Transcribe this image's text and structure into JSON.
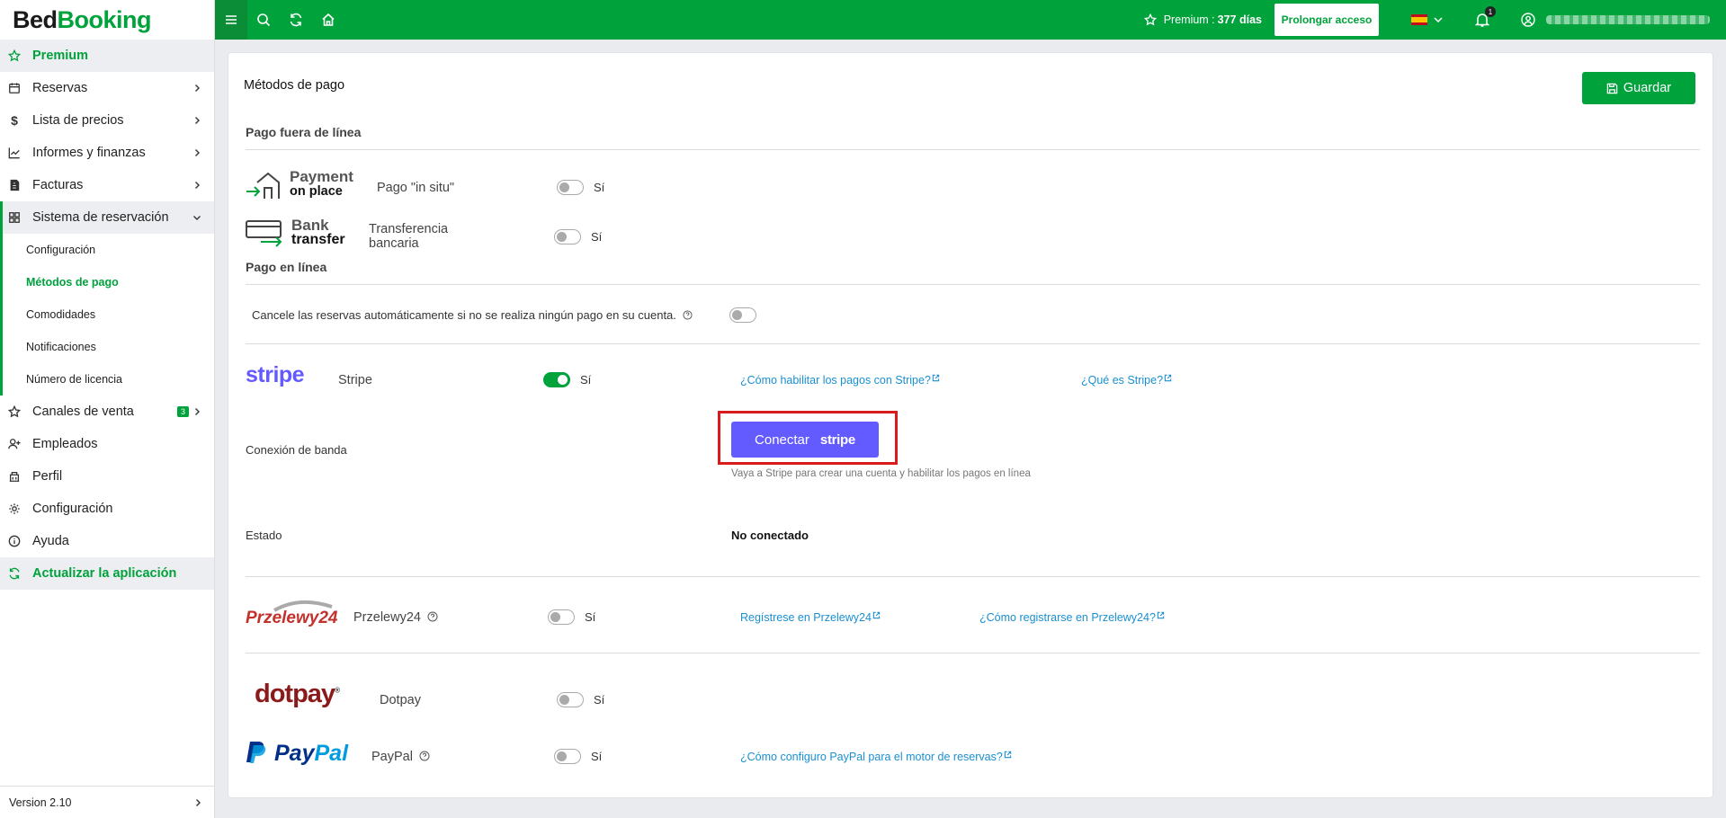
{
  "app": {
    "logo_part1": "Bed",
    "logo_part2": "Booking"
  },
  "sidebar": {
    "premium": "Premium",
    "items": [
      {
        "label": "Reservas"
      },
      {
        "label": "Lista de precios"
      },
      {
        "label": "Informes y finanzas"
      },
      {
        "label": "Facturas"
      },
      {
        "label": "Sistema de reservación"
      }
    ],
    "submenu": [
      {
        "label": "Configuración"
      },
      {
        "label": "Métodos de pago"
      },
      {
        "label": "Comodidades"
      },
      {
        "label": "Notificaciones"
      },
      {
        "label": "Número de licencia"
      }
    ],
    "items2": [
      {
        "label": "Canales de venta",
        "badge": "3"
      },
      {
        "label": "Empleados"
      },
      {
        "label": "Perfil"
      },
      {
        "label": "Configuración"
      },
      {
        "label": "Ayuda"
      }
    ],
    "update": "Actualizar la aplicación",
    "version": "Version 2.10"
  },
  "topbar": {
    "premium_label": "Premium :",
    "premium_days": "377 días",
    "prolong": "Prolongar acceso",
    "notifications": "1"
  },
  "main": {
    "title": "Métodos de pago",
    "save": "Guardar",
    "offline_title": "Pago fuera de línea",
    "online_title": "Pago en línea",
    "toggle_yes": "Sí",
    "payment_on_place": {
      "logo_line1": "Payment",
      "logo_line2": "on place",
      "name": "Pago \"in situ\""
    },
    "bank_transfer": {
      "logo_line1": "Bank",
      "logo_line2": "transfer",
      "name_line1": "Transferencia",
      "name_line2": "bancaria"
    },
    "auto_cancel": "Cancele las reservas automáticamente si no se realiza ningún pago en su cuenta.",
    "stripe": {
      "logo": "stripe",
      "name": "Stripe",
      "link_how": "¿Cómo habilitar los pagos con Stripe?",
      "link_what": "¿Qué es Stripe?",
      "connection_label": "Conexión de banda",
      "connect_label": "Conectar",
      "connect_brand": "stripe",
      "helper": "Vaya a Stripe para crear una cuenta y habilitar los pagos en línea",
      "status_label": "Estado",
      "status_value": "No conectado"
    },
    "przelewy": {
      "logo": "Przelewy24",
      "name": "Przelewy24",
      "link_register": "Regístrese en Przelewy24",
      "link_how": "¿Cómo registrarse en Przelewy24?"
    },
    "dotpay": {
      "logo": "dotpay",
      "name": "Dotpay"
    },
    "paypal": {
      "logo": "PayPal",
      "name": "PayPal",
      "link_how": "¿Cómo configuro PayPal para el motor de reservas?"
    }
  },
  "colors": {
    "brand": "#00a23c",
    "stripe": "#635bff",
    "link": "#1a8fd1",
    "highlight": "#d81b1b"
  }
}
